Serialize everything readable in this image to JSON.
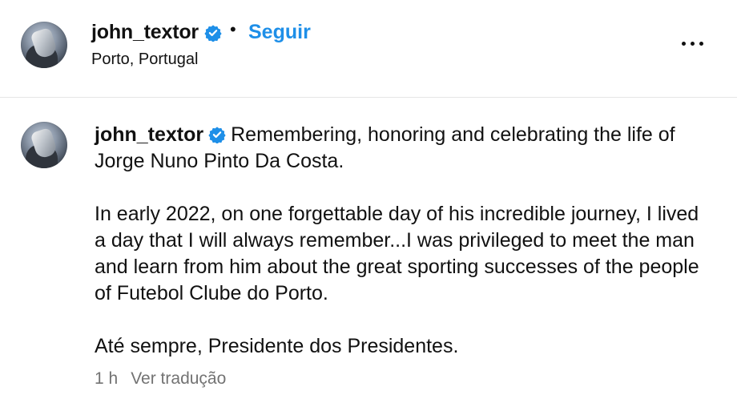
{
  "header": {
    "username": "john_textor",
    "separator": "•",
    "follow_label": "Seguir",
    "location": "Porto, Portugal"
  },
  "icons": {
    "verified": "verified-badge-icon",
    "more": "more-options-icon",
    "verified_color": "#1e8fe8"
  },
  "comment": {
    "username": "john_textor",
    "line1": "Remembering, honoring and celebrating the life of Jorge Nuno Pinto Da Costa.",
    "paragraph2": "In early 2022, on one forgettable day of his incredible journey, I lived a day that I will always remember...I was privileged to meet the man and learn from him about the great sporting successes of the people of Futebol Clube do Porto.",
    "paragraph3": "Até sempre, Presidente dos Presidentes.",
    "time": "1 h",
    "translate_label": "Ver tradução"
  }
}
